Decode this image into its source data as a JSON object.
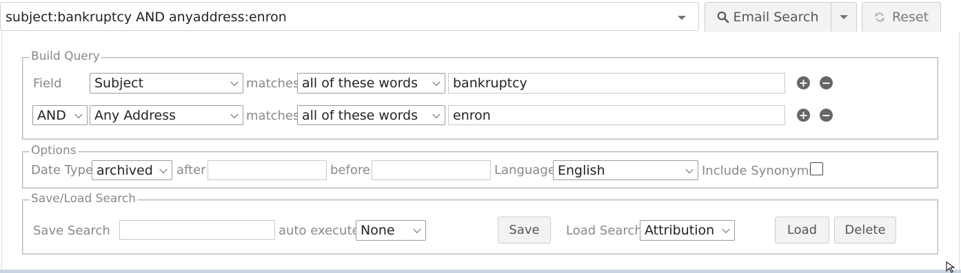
{
  "search": {
    "query": "subject:bankruptcy AND anyaddress:enron",
    "email_search_label": "Email Search",
    "reset_label": "Reset"
  },
  "build_query": {
    "legend": "Build Query",
    "field_label": "Field",
    "rows": [
      {
        "field": "Subject",
        "matches_label": "matches",
        "mode": "all of these words",
        "value": "bankruptcy"
      },
      {
        "operator": "AND",
        "field": "Any Address",
        "matches_label": "matches",
        "mode": "all of these words",
        "value": "enron"
      }
    ]
  },
  "options": {
    "legend": "Options",
    "date_type_label": "Date Type",
    "date_type": "archived",
    "after_label": "after",
    "after_value": "",
    "before_label": "before",
    "before_value": "",
    "language_label": "Language",
    "language": "English",
    "include_synonyms_label": "Include Synonyms",
    "include_synonyms": false
  },
  "save_load": {
    "legend": "Save/Load Search",
    "save_search_label": "Save Search",
    "save_search_value": "",
    "auto_execute_label": "auto execute",
    "auto_execute": "None",
    "save_button": "Save",
    "load_search_label": "Load Search",
    "load_search": "Attribution",
    "load_button": "Load",
    "delete_button": "Delete"
  },
  "icons": {
    "search": "search-icon",
    "reset": "refresh-icon",
    "add": "plus-circle-icon",
    "remove": "minus-circle-icon"
  }
}
